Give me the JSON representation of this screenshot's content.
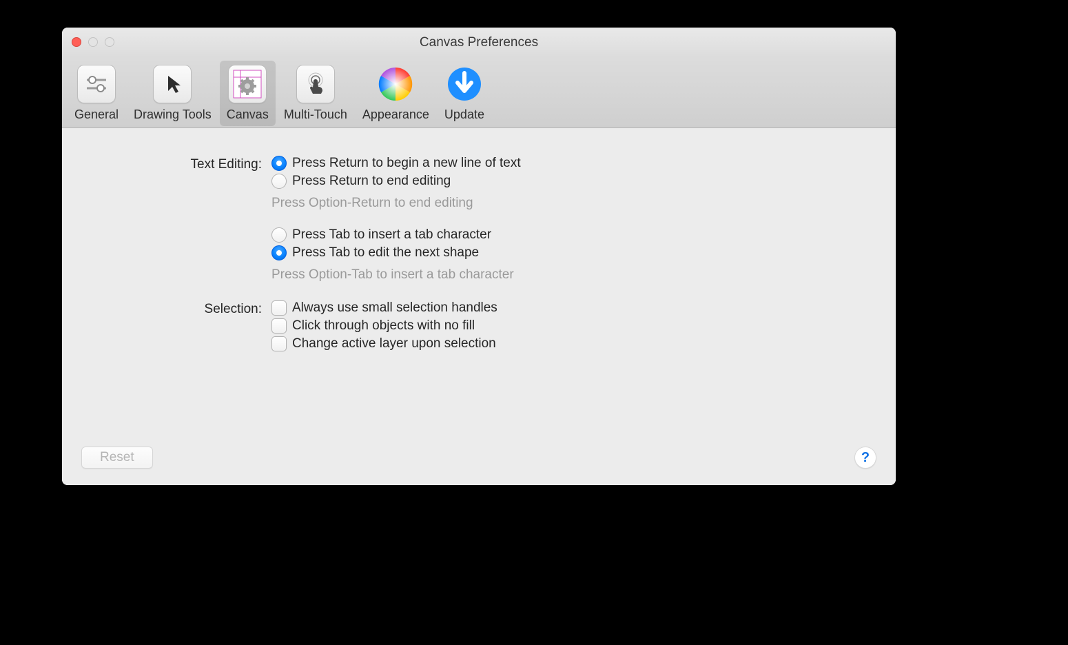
{
  "window": {
    "title": "Canvas Preferences"
  },
  "tabs": [
    {
      "id": "general",
      "label": "General",
      "selected": false
    },
    {
      "id": "drawingtools",
      "label": "Drawing Tools",
      "selected": false
    },
    {
      "id": "canvas",
      "label": "Canvas",
      "selected": true
    },
    {
      "id": "multitouch",
      "label": "Multi-Touch",
      "selected": false
    },
    {
      "id": "appearance",
      "label": "Appearance",
      "selected": false
    },
    {
      "id": "update",
      "label": "Update",
      "selected": false
    }
  ],
  "sections": {
    "textEditing": {
      "label": "Text Editing:",
      "return": {
        "options": [
          {
            "label": "Press Return to begin a new line of text",
            "selected": true
          },
          {
            "label": "Press Return to end editing",
            "selected": false
          }
        ],
        "hint": "Press Option-Return to end editing"
      },
      "tab": {
        "options": [
          {
            "label": "Press Tab to insert a tab character",
            "selected": false
          },
          {
            "label": "Press Tab to edit the next shape",
            "selected": true
          }
        ],
        "hint": "Press Option-Tab to insert a tab character"
      }
    },
    "selection": {
      "label": "Selection:",
      "checks": [
        {
          "label": "Always use small selection handles",
          "checked": false
        },
        {
          "label": "Click through objects with no fill",
          "checked": false
        },
        {
          "label": "Change active layer upon selection",
          "checked": false
        }
      ]
    }
  },
  "footer": {
    "reset": "Reset"
  },
  "colors": {
    "accent": "#0a84ff"
  }
}
